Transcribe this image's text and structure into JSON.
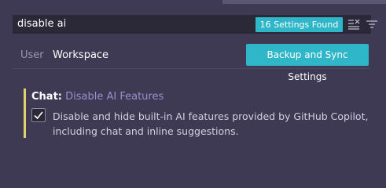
{
  "search": {
    "value": "disable ai",
    "results_badge": "16 Settings Found",
    "clear_icon": "clear-filter-icon",
    "filter_icon": "filter-icon"
  },
  "tabs": [
    {
      "label": "User",
      "active": false
    },
    {
      "label": "Workspace",
      "active": true
    }
  ],
  "sync_button": {
    "label": "Backup and Sync Settings"
  },
  "setting": {
    "category": "Chat:",
    "name": "Disable AI Features",
    "checked": true,
    "description": "Disable and hide built-in AI features provided by GitHub Copilot, including chat and inline suggestions."
  },
  "colors": {
    "background": "#3f3a53",
    "accent": "#2fb6c9",
    "modified_bar": "#e0d26a",
    "setting_name": "#9b8fd0"
  }
}
